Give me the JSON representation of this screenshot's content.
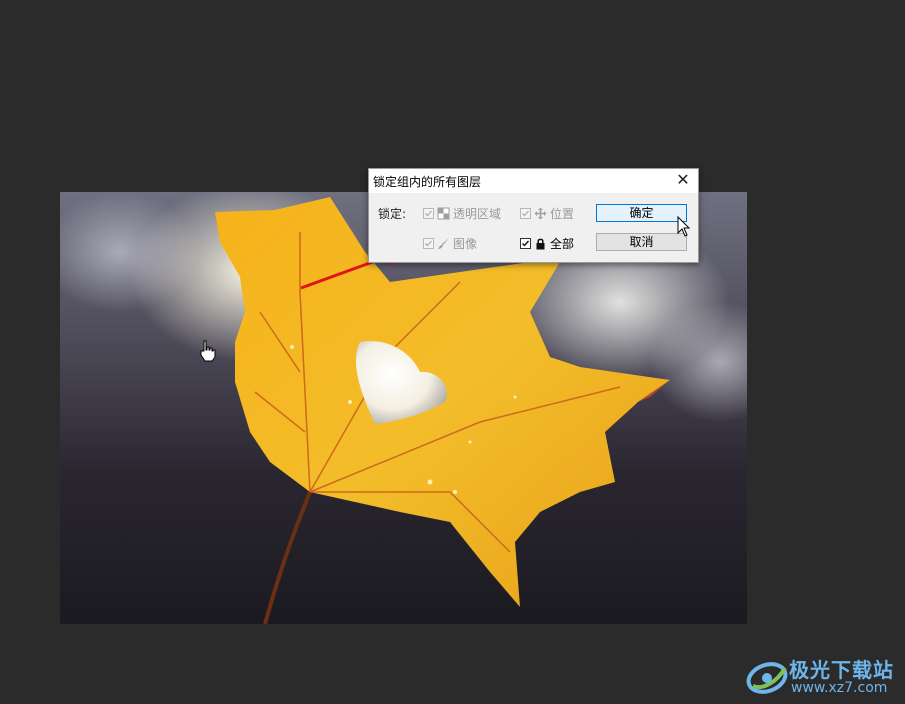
{
  "dialog": {
    "title": "锁定组内的所有图层",
    "close_label": "✕",
    "lock_label": "锁定:",
    "options": {
      "transparent": {
        "label": "透明区域",
        "checked": true,
        "disabled": true,
        "icon": "checkerboard-icon"
      },
      "position": {
        "label": "位置",
        "checked": true,
        "disabled": true,
        "icon": "move-icon"
      },
      "image": {
        "label": "图像",
        "checked": true,
        "disabled": true,
        "icon": "brush-icon"
      },
      "all": {
        "label": "全部",
        "checked": true,
        "disabled": false,
        "icon": "lock-icon"
      }
    },
    "ok_label": "确定",
    "cancel_label": "取消"
  },
  "watermark": {
    "name": "极光下载站",
    "url": "www.xz7.com"
  },
  "colors": {
    "workspace_bg": "#2b2b2b",
    "annotation_arrow": "#e0141a",
    "primary_button_border": "#0078d7",
    "watermark": "#6db5ea"
  }
}
